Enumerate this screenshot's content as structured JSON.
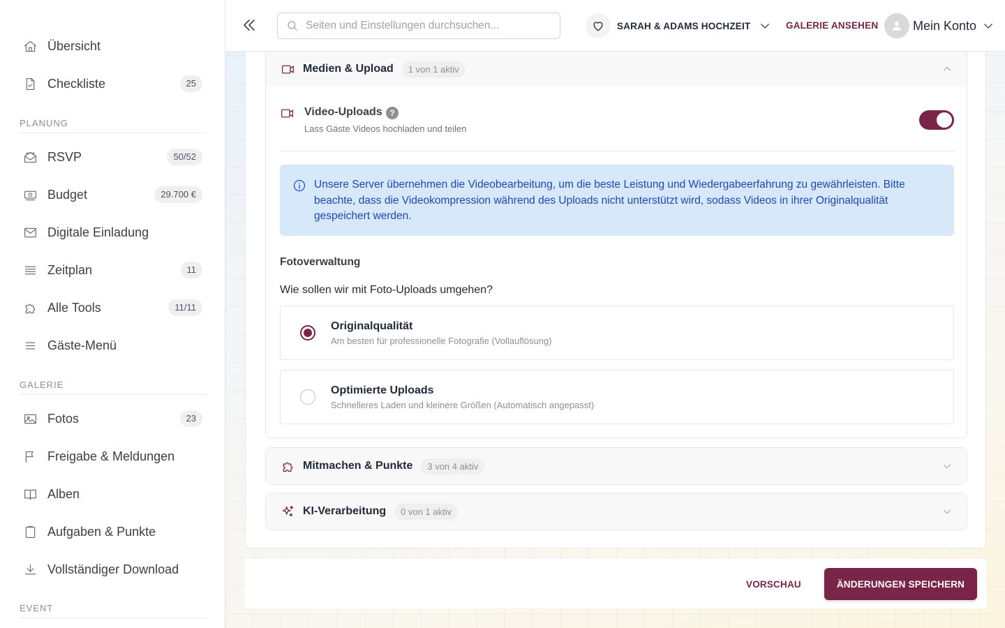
{
  "sidebar": {
    "items": [
      {
        "label": "Übersicht",
        "badge": null,
        "icon": "home-icon"
      },
      {
        "label": "Checkliste",
        "badge": "25",
        "icon": "checklist-icon"
      },
      {
        "label": "RSVP",
        "badge": "50/52",
        "icon": "envelope-open-icon"
      },
      {
        "label": "Budget",
        "badge": "29.700 €",
        "icon": "banknote-icon"
      },
      {
        "label": "Digitale Einladung",
        "badge": null,
        "icon": "mail-icon"
      },
      {
        "label": "Zeitplan",
        "badge": "11",
        "icon": "list-icon"
      },
      {
        "label": "Alle Tools",
        "badge": "11/11",
        "icon": "puzzle-icon"
      },
      {
        "label": "Gäste-Menü",
        "badge": null,
        "icon": "menu-icon"
      },
      {
        "label": "Fotos",
        "badge": "23",
        "icon": "image-icon"
      },
      {
        "label": "Freigabe & Meldungen",
        "badge": null,
        "icon": "flag-icon"
      },
      {
        "label": "Alben",
        "badge": null,
        "icon": "book-icon"
      },
      {
        "label": "Aufgaben & Punkte",
        "badge": null,
        "icon": "clipboard-icon"
      },
      {
        "label": "Vollständiger Download",
        "badge": null,
        "icon": "download-icon"
      }
    ],
    "sections": {
      "planning": "PLANUNG",
      "gallery": "GALERIE",
      "event": "EVENT"
    }
  },
  "topbar": {
    "search_placeholder": "Seiten und Einstellungen durchsuchen...",
    "event_name": "SARAH & ADAMS HOCHZEIT",
    "gallery_link": "GALERIE ANSEHEN",
    "account_label": "Mein Konto"
  },
  "media_panel": {
    "title": "Medien & Upload",
    "badge": "1 von 1 aktiv",
    "video": {
      "title": "Video-Uploads",
      "help": "?",
      "description": "Lass Gäste Videos hochladen und teilen",
      "enabled": true
    },
    "info_text": "Unsere Server übernehmen die Videobearbeitung, um die beste Leistung und Wiedergabeerfahrung zu gewährleisten. Bitte beachte, dass die Videokompression während des Uploads nicht unterstützt wird, sodass Videos in ihrer Originalqualität gespeichert werden.",
    "photo_section_title": "Fotoverwaltung",
    "photo_question": "Wie sollen wir mit Foto-Uploads umgehen?",
    "options": [
      {
        "title": "Originalqualität",
        "description": "Am besten für professionelle Fotografie (Vollauflösung)",
        "selected": true
      },
      {
        "title": "Optimierte Uploads",
        "description": "Schnelleres Laden und kleinere Größen (Automatisch angepasst)",
        "selected": false
      }
    ]
  },
  "panels": [
    {
      "title": "Mitmachen & Punkte",
      "badge": "3 von 4 aktiv",
      "icon": "puzzle-icon"
    },
    {
      "title": "KI-Verarbeitung",
      "badge": "0 von 1 aktiv",
      "icon": "sparkles-icon"
    }
  ],
  "footer": {
    "preview_label": "VORSCHAU",
    "save_label": "ÄNDERUNGEN SPEICHERN"
  },
  "colors": {
    "accent": "#7a2548",
    "info_bg": "#d7e8fb",
    "info_text": "#1e48b5"
  }
}
